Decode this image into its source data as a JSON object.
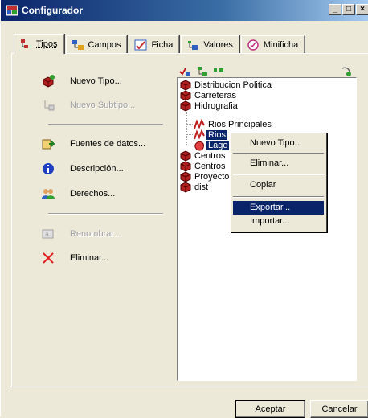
{
  "window": {
    "title": "Configurador",
    "minimize_glyph": "_",
    "maximize_glyph": "□",
    "close_glyph": "×"
  },
  "tabs": [
    {
      "label": "Tipos",
      "active": true,
      "icon": "tipos-icon"
    },
    {
      "label": "Campos",
      "active": false,
      "icon": "campos-icon"
    },
    {
      "label": "Ficha",
      "active": false,
      "icon": "ficha-icon"
    },
    {
      "label": "Valores",
      "active": false,
      "icon": "valores-icon"
    },
    {
      "label": "Minificha",
      "active": false,
      "icon": "minificha-icon"
    }
  ],
  "actions": {
    "nuevo_tipo": "Nuevo Tipo...",
    "nuevo_subtipo": "Nuevo Subtipo...",
    "fuentes": "Fuentes de datos...",
    "descripcion": "Descripción...",
    "derechos": "Derechos...",
    "renombrar": "Renombrar...",
    "eliminar": "Eliminar..."
  },
  "tree": {
    "distribucion": "Distribucion Politica",
    "carreteras": "Carreteras",
    "hidrografia": "Hidrografia",
    "rios_principales": "Rios Principales",
    "rios": "Rios",
    "lagos": "Lago",
    "centros1": "Centros",
    "centros2": "Centros",
    "proyecto": "Proyecto",
    "dist": "dist"
  },
  "context_menu": {
    "nuevo_tipo": "Nuevo Tipo...",
    "eliminar": "Eliminar...",
    "copiar": "Copiar",
    "exportar": "Exportar...",
    "importar": "Importar..."
  },
  "buttons": {
    "aceptar": "Aceptar",
    "cancelar": "Cancelar"
  },
  "colors": {
    "titlebar": "#0a246a",
    "selection": "#0a246a",
    "face": "#ece9d8"
  }
}
